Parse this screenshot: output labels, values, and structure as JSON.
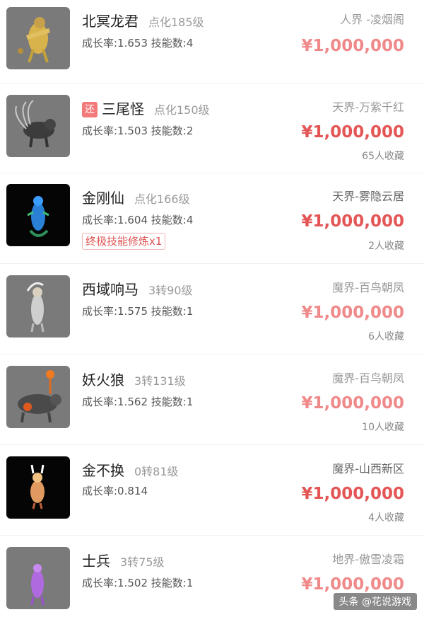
{
  "items": [
    {
      "name": "北冥龙君",
      "level": "点化185级",
      "stats": "成长率:1.653  技能数:4",
      "server": "人界 -凌烟阁",
      "price": "¥1,000,000",
      "favorites": ""
    },
    {
      "name": "三尾怪",
      "return_tag": "还",
      "level": "点化150级",
      "stats": "成长率:1.503  技能数:2",
      "server": "天界-万紫千红",
      "price": "¥1,000,000",
      "favorites": "65人收藏"
    },
    {
      "name": "金刚仙",
      "level": "点化166级",
      "stats": "成长率:1.604  技能数:4",
      "skill_badge": "终极技能修炼x1",
      "server": "天界-雾隐云居",
      "price": "¥1,000,000",
      "favorites": "2人收藏"
    },
    {
      "name": "西域响马",
      "level": "3转90级",
      "stats": "成长率:1.575  技能数:1",
      "server": "魔界-百鸟朝凤",
      "price": "¥1,000,000",
      "favorites": "6人收藏"
    },
    {
      "name": "妖火狼",
      "level": "3转131级",
      "stats": "成长率:1.562  技能数:1",
      "server": "魔界-百鸟朝凤",
      "price": "¥1,000,000",
      "favorites": "10人收藏"
    },
    {
      "name": "金不换",
      "level": "0转81级",
      "stats": "成长率:0.814",
      "server": "魔界-山西新区",
      "price": "¥1,000,000",
      "favorites": "4人收藏"
    },
    {
      "name": "士兵",
      "level": "3转75级",
      "stats": "成长率:1.502  技能数:1",
      "server": "地界-傲雪凌霜",
      "price": "¥1,000,000",
      "favorites": ""
    }
  ],
  "watermark": "头条 @花说游戏",
  "colors": {
    "price": "#e45656",
    "badge": "#f37a7a"
  }
}
